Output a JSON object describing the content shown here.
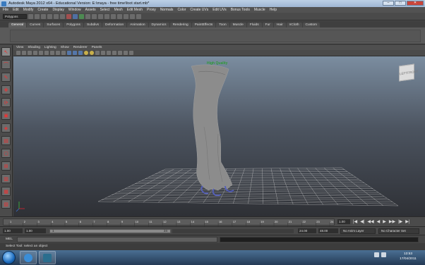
{
  "window": {
    "title": "Autodesk Maya 2012 x64 - Educational Version: E:\\maya - free time\\foot start.mb*",
    "controls": [
      "–",
      "□",
      "✕"
    ]
  },
  "menubar": [
    "File",
    "Edit",
    "Modify",
    "Create",
    "Display",
    "Window",
    "Assets",
    "Select",
    "Mesh",
    "Edit Mesh",
    "Proxy",
    "Normals",
    "Color",
    "Create UVs",
    "Edit UVs",
    "Bonus Tools",
    "Muscle",
    "Help"
  ],
  "statusline": {
    "mode": "Polygons"
  },
  "shelf_tabs": [
    "General",
    "Curves",
    "Surfaces",
    "Polygons",
    "Subdivs",
    "Deformation",
    "Animation",
    "Dynamics",
    "Rendering",
    "PaintEffects",
    "Toon",
    "Muscle",
    "Fluids",
    "Fur",
    "Hair",
    "nCloth",
    "Custom"
  ],
  "active_shelf_tab": "General",
  "panel_menu": [
    "View",
    "Shading",
    "Lighting",
    "Show",
    "Renderer",
    "Panels"
  ],
  "viewport": {
    "overlay_label": "High Quality",
    "viewcube": {
      "left": "LEFT",
      "front": "FRONT"
    },
    "colors": {
      "ground_grid": "#cfcfcf",
      "mesh": "#8c8c8c",
      "claws": "#5560b8",
      "hq_label": "#2f9a36"
    }
  },
  "timeline": {
    "ticks": [
      "1",
      "2",
      "3",
      "4",
      "5",
      "6",
      "7",
      "8",
      "9",
      "10",
      "11",
      "12",
      "13",
      "14",
      "15",
      "16",
      "17",
      "18",
      "19",
      "20",
      "21",
      "22",
      "23",
      "24"
    ],
    "current_frame": "1.00",
    "playback_icons": [
      "|◀",
      "◀|",
      "◀◀",
      "◀",
      "▶",
      "▶▶",
      "|▶",
      "▶|"
    ]
  },
  "range": {
    "start": "1.00",
    "start2": "1.00",
    "bar_left": "1",
    "bar_right": "24",
    "end": "24.00",
    "end2": "48.00",
    "anim_layer": "No Anim Layer",
    "char_set": "No Character Set"
  },
  "commandline": {
    "label": "MEL"
  },
  "helpline": {
    "text": "Select Tool: select an object"
  },
  "taskbar": {
    "clock_time": "13:53",
    "clock_date": "17/04/2011"
  }
}
